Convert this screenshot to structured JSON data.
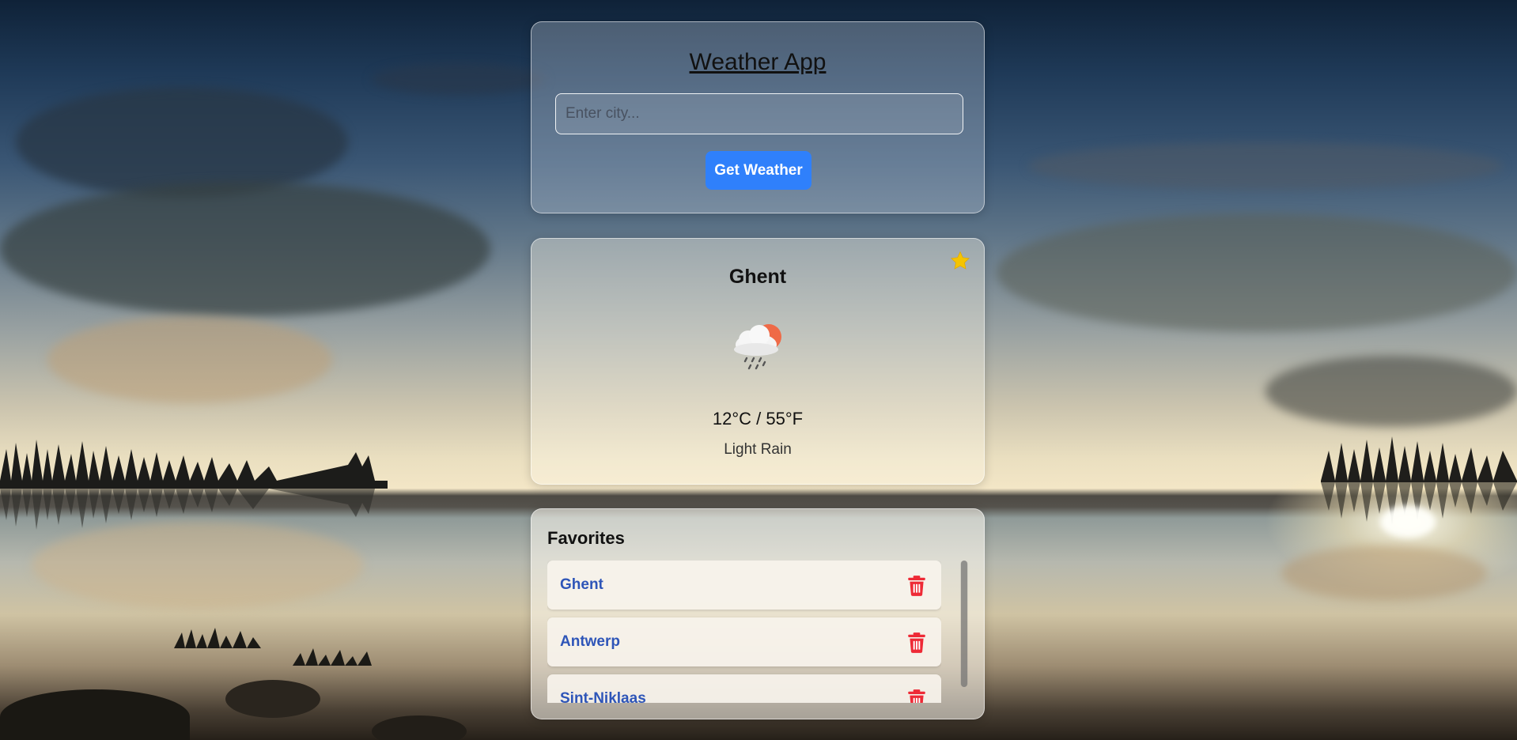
{
  "app": {
    "title": "Weather App"
  },
  "search": {
    "placeholder": "Enter city...",
    "value": "",
    "button_label": "Get Weather"
  },
  "weather": {
    "city": "Ghent",
    "temperature": "12°C / 55°F",
    "description": "Light Rain",
    "icon": "cloud-sun-rain-icon",
    "favorited": true
  },
  "favorites": {
    "title": "Favorites",
    "items": [
      {
        "label": "Ghent"
      },
      {
        "label": "Antwerp"
      },
      {
        "label": "Sint-Niklaas"
      }
    ]
  },
  "colors": {
    "button": "#2f80fb",
    "star": "#f5c400",
    "trash": "#ee2a36",
    "fav_link": "#2e55b8"
  }
}
